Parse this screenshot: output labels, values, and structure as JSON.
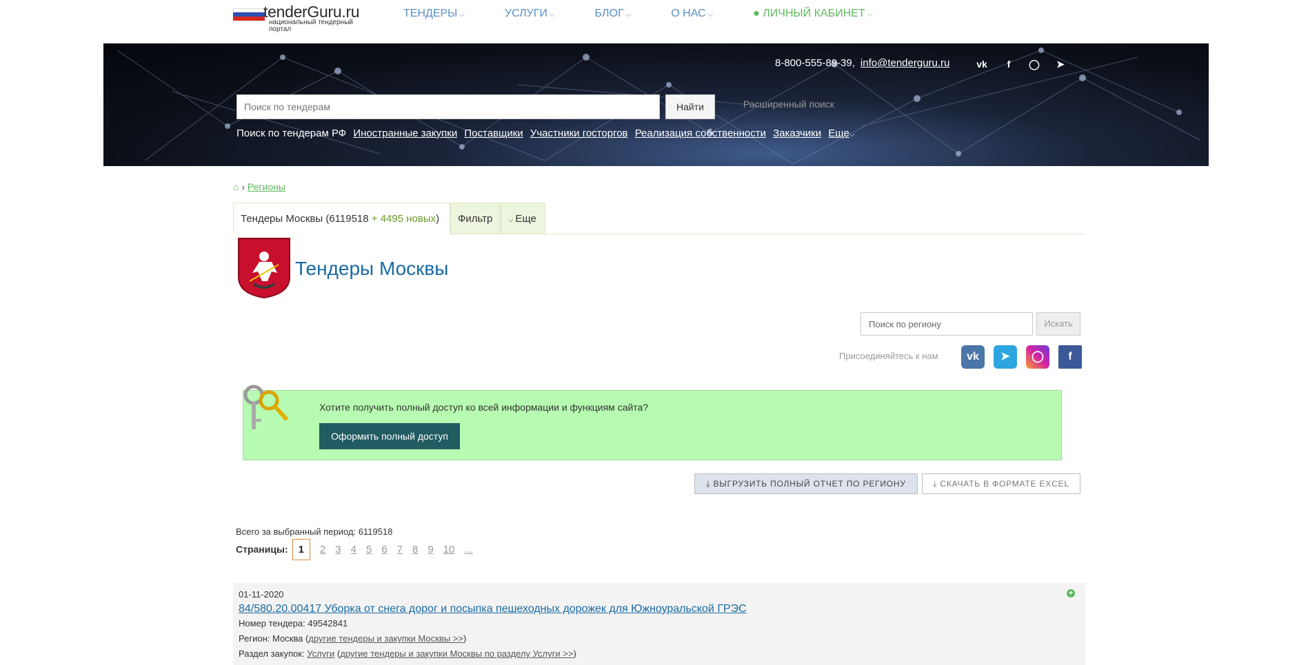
{
  "logo": {
    "name": "tenderGuru.ru",
    "subtitle": "национальный тендерный портал"
  },
  "nav": [
    {
      "label": "ТЕНДЕРЫ"
    },
    {
      "label": "УСЛУГИ"
    },
    {
      "label": "БЛОГ"
    },
    {
      "label": "О НАС"
    },
    {
      "label": "ЛИЧНЫЙ КАБИНЕТ"
    }
  ],
  "contacts": {
    "phone": "8-800-555-89-39,",
    "email": "info@tenderguru.ru"
  },
  "hero_social": [
    "vk-icon",
    "facebook-icon",
    "instagram-icon",
    "telegram-icon"
  ],
  "search": {
    "placeholder": "Поиск по тендерам",
    "button": "Найти",
    "advanced": "Расширенный поиск"
  },
  "quicklinks": {
    "prefix": "Поиск по тендерам РФ",
    "links": [
      "Иностранные закупки",
      "Поставщики",
      "Участники госторгов",
      "Реализация собственности",
      "Заказчики",
      "Еще"
    ]
  },
  "breadcrumb": {
    "item": "Регионы"
  },
  "tabs": {
    "main_prefix": "Тендеры Москвы (6119518",
    "main_new": " + 4495 новых",
    "main_suffix": ")",
    "filter": "Фильтр",
    "more": "Еще"
  },
  "region": {
    "title": "Тендеры Москвы",
    "search_placeholder": "Поиск по региону",
    "search_button": "Искать",
    "join_label": "Присоединяйтесь к нам"
  },
  "social_colors": {
    "vk": "#4a76a8",
    "telegram": "#2ca5e0",
    "instagram": "#d6249f",
    "facebook": "#3b5998"
  },
  "promo": {
    "text": "Хотите получить полный доступ ко всей информации и функциям сайта?",
    "button": "Оформить полный доступ"
  },
  "export": {
    "full_report": "ВЫГРУЗИТЬ ПОЛНЫЙ ОТЧЕТ ПО РЕГИОНУ",
    "excel": "СКАЧАТЬ В ФОРМАТЕ EXCEL"
  },
  "totals": {
    "text": "Всего за выбранный период: 6119518"
  },
  "pagination": {
    "label": "Страницы:",
    "pages": [
      "1",
      "2",
      "3",
      "4",
      "5",
      "6",
      "7",
      "8",
      "9",
      "10",
      "..."
    ]
  },
  "tender": {
    "date": "01-11-2020",
    "title": "84/580.20.00417 Уборка от снега дорог и посыпка пешеходных дорожек для Южноуральской ГРЭС",
    "number": "Номер тендера: 49542841",
    "region_prefix": "Регион: Москва (",
    "region_link": "другие тендеры и закупки Москвы >>",
    "region_suffix": ")",
    "section_prefix": "Раздел закупок: ",
    "section_link": "Услуги",
    "section_mid": " (",
    "section_link2": "другие тендеры и закупки Москвы по разделу Услуги >>",
    "section_suffix": ")"
  }
}
